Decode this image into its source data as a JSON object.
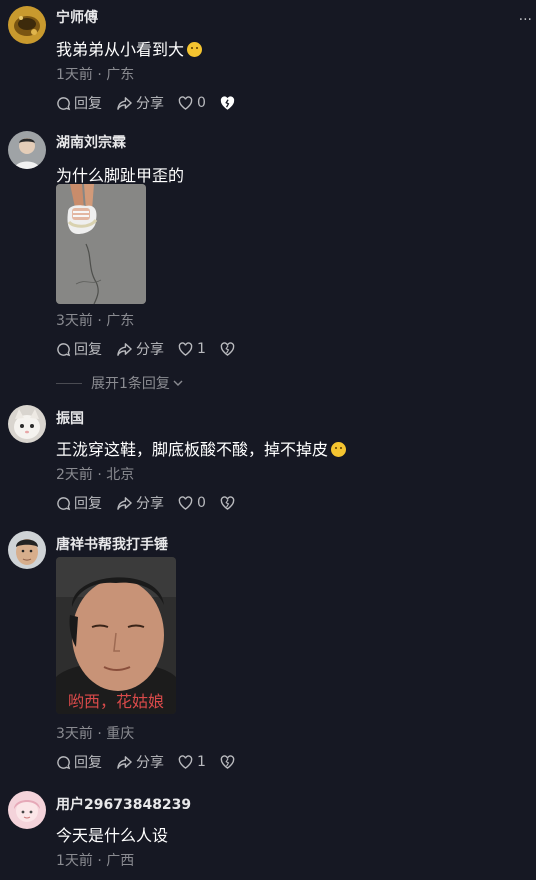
{
  "comments": [
    {
      "username": "宁师傅",
      "text": "我弟弟从小看到大",
      "emoji": "smiling-face-emoji",
      "meta": "1天前 · 广东",
      "reply_label": "回复",
      "share_label": "分享",
      "likes": "0"
    },
    {
      "username": "湖南刘宗霖",
      "text": "为什么脚趾甲歪的",
      "image": "photo of foot in white platform sandal on asphalt",
      "meta": "3天前 · 广东",
      "reply_label": "回复",
      "share_label": "分享",
      "likes": "1",
      "expand_label": "展开1条回复"
    },
    {
      "username": "振国",
      "text": "王泷穿这鞋，脚底板酸不酸，掉不掉皮",
      "emoji": "thinking-face-emoji",
      "meta": "2天前 · 北京",
      "reply_label": "回复",
      "share_label": "分享",
      "likes": "0"
    },
    {
      "username": "唐祥书帮我打手锤",
      "image_caption": "哟西，花姑娘",
      "meta": "3天前 · 重庆",
      "reply_label": "回复",
      "share_label": "分享",
      "likes": "1"
    },
    {
      "username": "用户29673848239",
      "text": "今天是什么人设",
      "meta": "1天前 · 广西"
    }
  ],
  "colors": {
    "background": "#161823",
    "secondary_text": "#8a8b91",
    "caption_red": "#d94a4a"
  }
}
